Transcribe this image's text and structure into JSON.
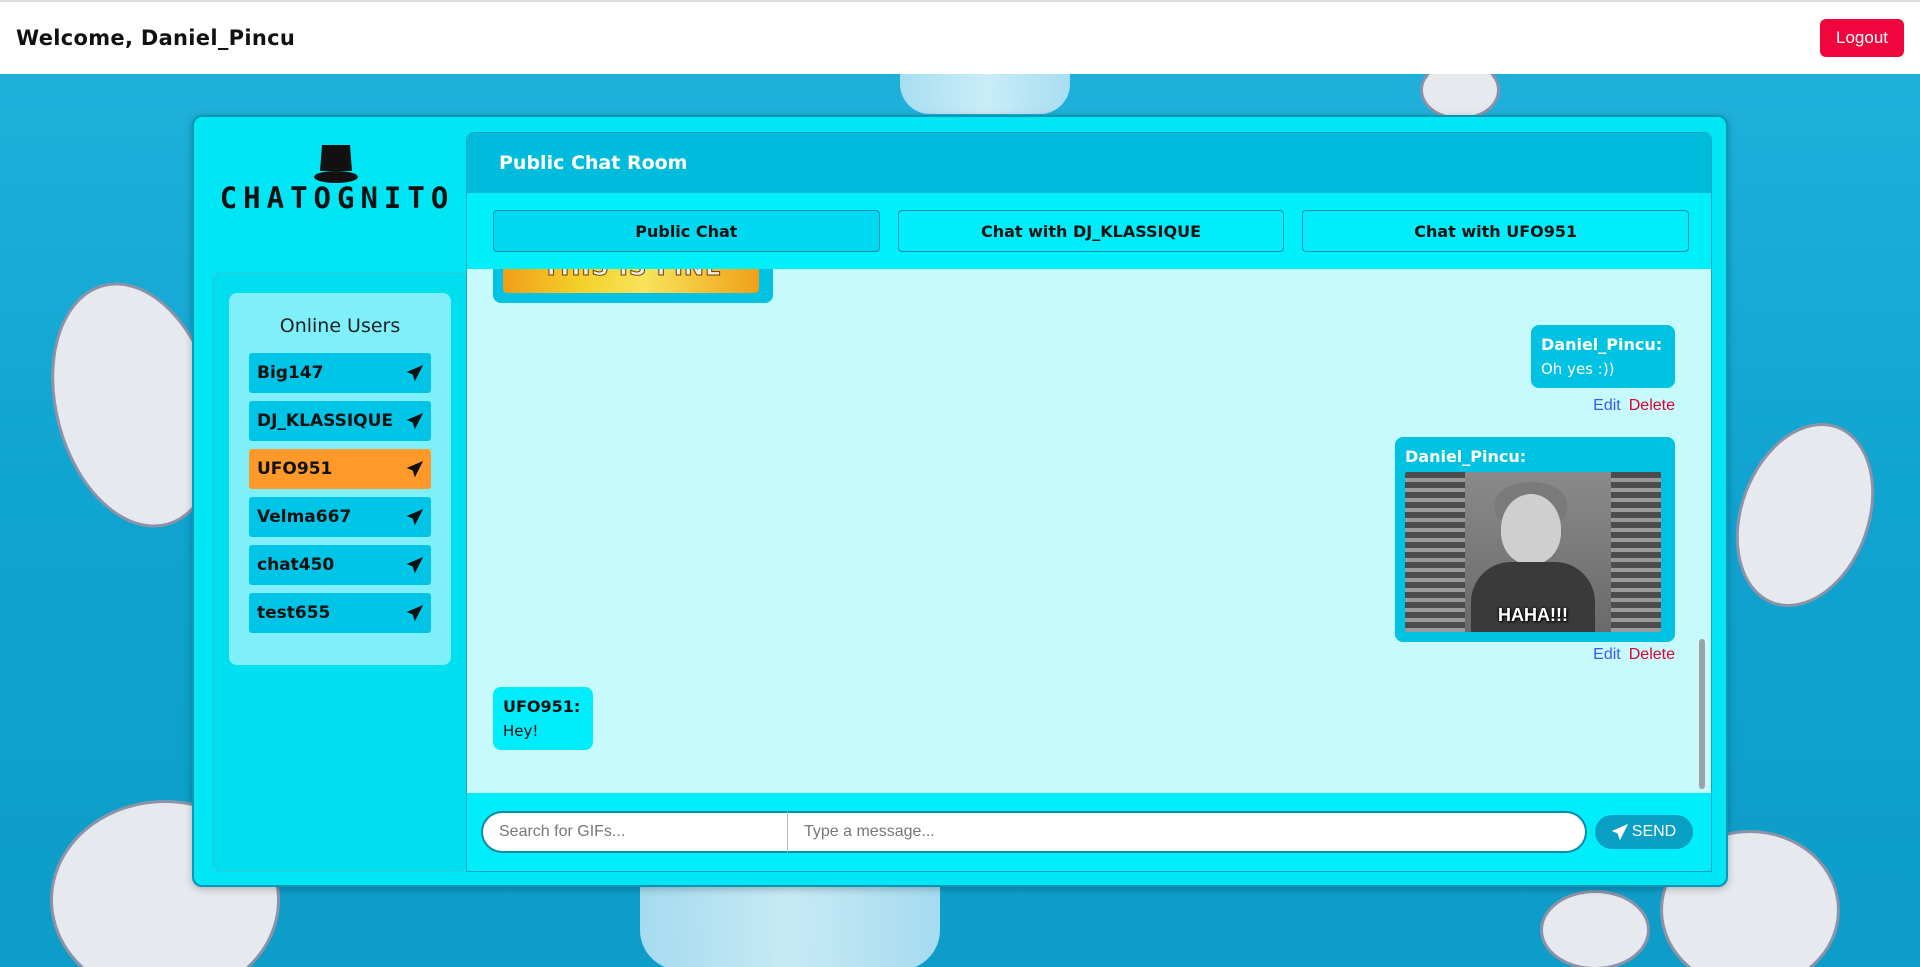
{
  "header": {
    "welcome_text": "Welcome, Daniel_Pincu",
    "logout_label": "Logout"
  },
  "brand": {
    "logo_text": "CHATOGNITO"
  },
  "sidebar": {
    "title": "Online Users",
    "users": [
      {
        "name": "Big147",
        "active": false
      },
      {
        "name": "DJ_KLASSIQUE",
        "active": false
      },
      {
        "name": "UFO951",
        "active": true
      },
      {
        "name": "Velma667",
        "active": false
      },
      {
        "name": "chat450",
        "active": false
      },
      {
        "name": "test655",
        "active": false
      }
    ]
  },
  "chat": {
    "room_title": "Public Chat Room",
    "tabs": [
      {
        "label": "Public Chat",
        "active": true
      },
      {
        "label": "Chat with DJ_KLASSIQUE",
        "active": false
      },
      {
        "label": "Chat with UFO951",
        "active": false
      }
    ],
    "partial_gif_text": "THIS IS FINE",
    "messages": [
      {
        "author": "Daniel_Pincu:",
        "text": "Oh yes :))",
        "edit": "Edit",
        "delete": "Delete"
      },
      {
        "author": "Daniel_Pincu:",
        "gif_caption": "HAHA!!!",
        "edit": "Edit",
        "delete": "Delete"
      },
      {
        "author": "UFO951:",
        "text": "Hey!"
      }
    ]
  },
  "composer": {
    "gif_search_placeholder": "Search for GIFs...",
    "message_placeholder": "Type a message...",
    "send_label": "SEND"
  },
  "colors": {
    "accent": "#00c3e3",
    "logout": "#f0063d",
    "active_user": "#ff9a2a",
    "edit": "#3c59ea",
    "delete": "#e0002e"
  }
}
